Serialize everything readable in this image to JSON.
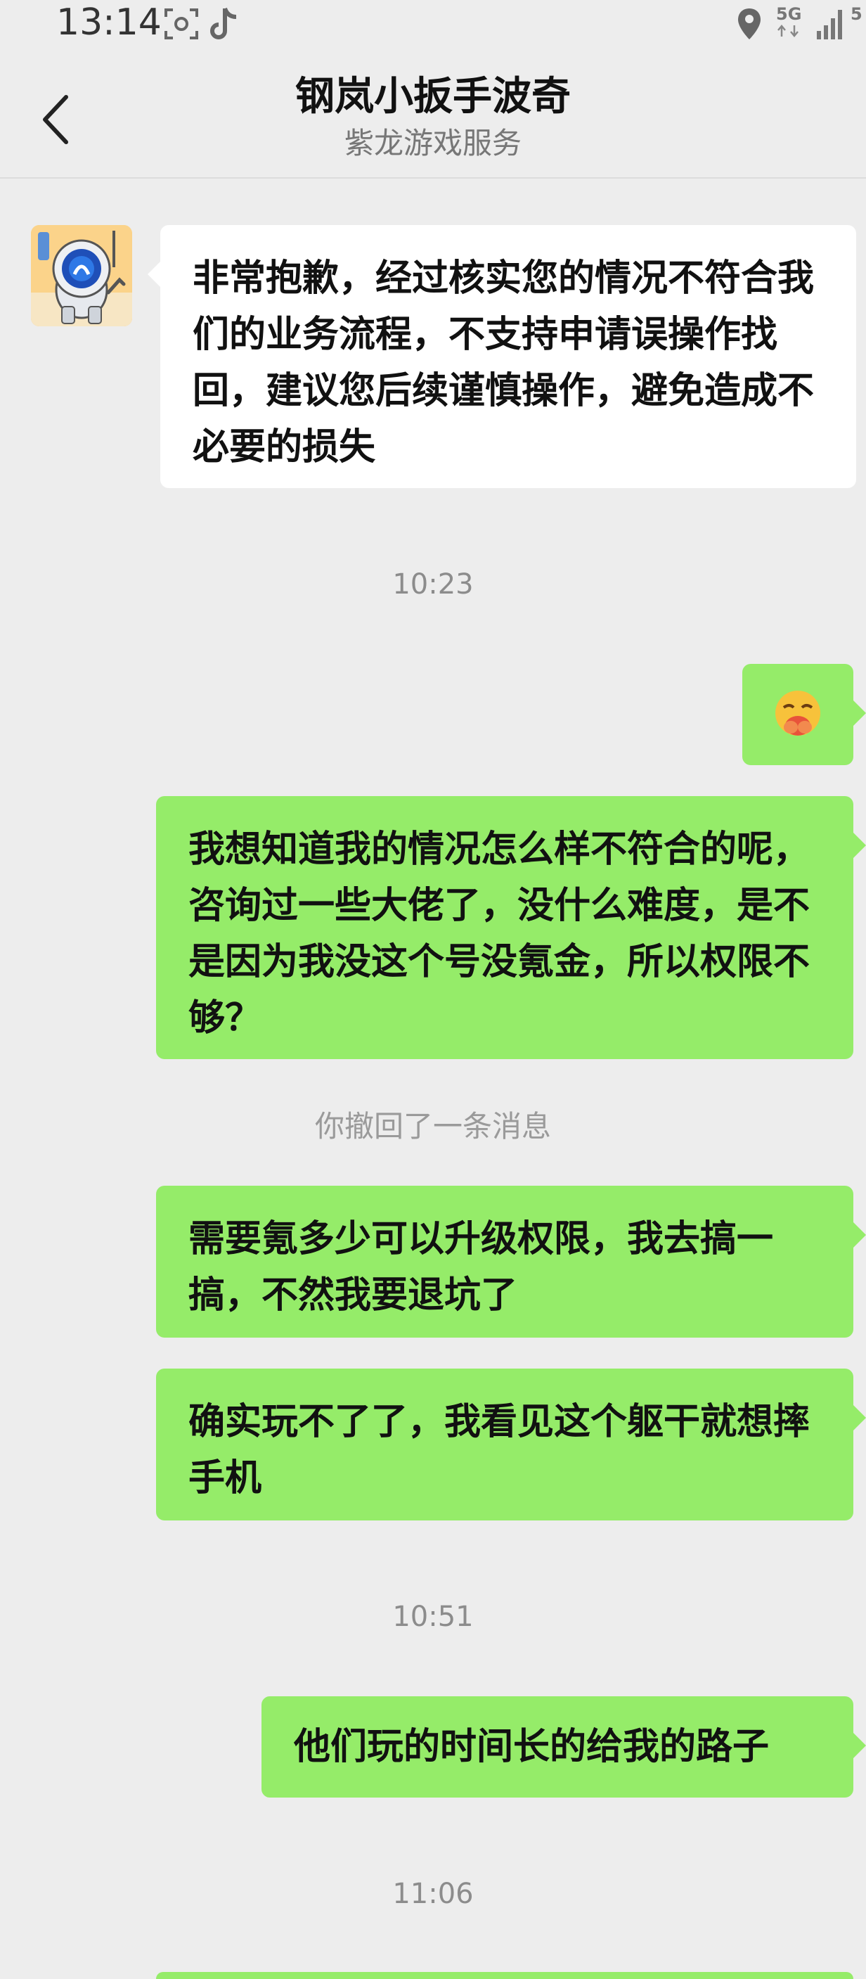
{
  "status_bar": {
    "time": "13:14",
    "network": "5G",
    "network2": "5"
  },
  "header": {
    "title": "钢岚小扳手波奇",
    "subtitle": "紫龙游戏服务"
  },
  "messages": [
    {
      "type": "in",
      "text": "非常抱歉，经过核实您的情况不符合我们的业务流程，不支持申请误操作找回，建议您后续谨慎操作，避免造成不必要的损失"
    },
    {
      "type": "time",
      "text": "10:23"
    },
    {
      "type": "out-emoji",
      "emoji": "🤭"
    },
    {
      "type": "out",
      "text": "我想知道我的情况怎么样不符合的呢，咨询过一些大佬了，没什么难度，是不是因为我没这个号没氪金，所以权限不够？"
    },
    {
      "type": "recall",
      "text": "你撤回了一条消息"
    },
    {
      "type": "out",
      "text": "需要氪多少可以升级权限，我去搞一搞，不然我要退坑了"
    },
    {
      "type": "out",
      "text": "确实玩不了了，我看见这个躯干就想摔手机"
    },
    {
      "type": "time",
      "text": "10:51"
    },
    {
      "type": "out",
      "text": "他们玩的时间长的给我的路子"
    },
    {
      "type": "time",
      "text": "11:06"
    }
  ],
  "colors": {
    "background": "#ededed",
    "outgoing_bubble": "#95ec69",
    "incoming_bubble": "#ffffff"
  }
}
